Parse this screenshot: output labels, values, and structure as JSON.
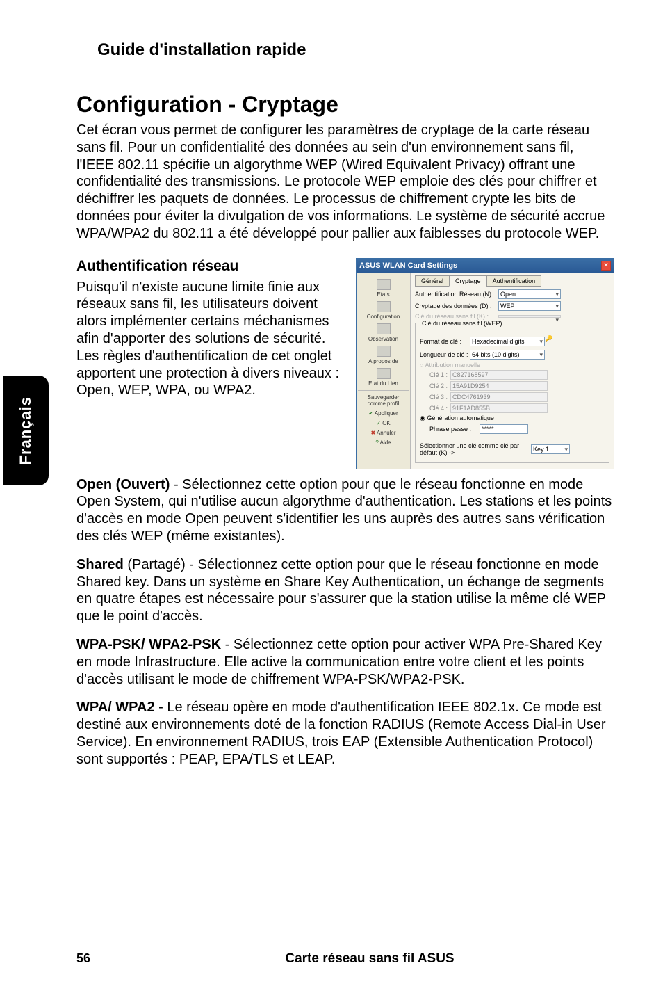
{
  "side_tab": "Français",
  "header": "Guide d'installation rapide",
  "title": "Configuration - Cryptage",
  "intro": "Cet écran vous permet de configurer les paramètres de cryptage de la carte réseau sans fil. Pour un confidentialité des données au sein d'un environnement sans fil, l'IEEE 802.11 spécifie un algorythme WEP (Wired Equivalent Privacy) offrant une confidentialité des transmissions. Le protocole WEP emploie des clés pour chiffrer et déchiffrer les paquets de données. Le processus de chiffrement crypte les bits de données pour éviter la divulgation de vos informations. Le système de sécurité accrue WPA/WPA2 du 802.11 a été développé pour pallier aux faiblesses du protocole WEP.",
  "section_heading": "Authentification réseau",
  "section_body": "Puisqu'il n'existe aucune limite finie aux réseaux sans fil, les utilisateurs doivent alors implémenter certains méchanismes afin d'apporter des solutions de sécurité. Les règles d'authentification de cet onglet apportent une protection à divers niveaux : Open, WEP, WPA, ou WPA2.",
  "open_label": "Open (Ouvert)",
  "open_text": " - Sélectionnez cette option pour que le réseau fonctionne en mode Open System, qui n'utilise aucun algorythme d'authentication. Les stations et les points d'accès en mode Open peuvent s'identifier les uns auprès des autres sans vérification des clés WEP (même existantes).",
  "shared_label": "Shared",
  "shared_text": " (Partagé) - Sélectionnez cette option pour que le réseau fonctionne en mode Shared key. Dans un système en Share Key Authentication, un échange de segments en quatre étapes est nécessaire pour s'assurer que la station utilise la même clé WEP que le point d'accès.",
  "wpa_psk_label": "WPA-PSK/ WPA2-PSK",
  "wpa_psk_text": " - Sélectionnez cette option pour activer WPA Pre-Shared Key en mode Infrastructure. Elle active la communication entre votre client et les points d'accès utilisant le mode de chiffrement WPA-PSK/WPA2-PSK.",
  "wpa_label": "WPA/ WPA2",
  "wpa_text": " - Le réseau opère en mode d'authentification IEEE 802.1x. Ce mode est destiné aux environnements doté de la fonction RADIUS (Remote Access Dial-in User Service). En environnement RADIUS, trois EAP (Extensible Authentication Protocol) sont supportés : PEAP, EPA/TLS et LEAP.",
  "dialog": {
    "title": "ASUS WLAN Card Settings",
    "close": "×",
    "nav": {
      "etats": "Etats",
      "configuration": "Configuration",
      "observation": "Observation",
      "apropos": "A propos de",
      "etat_lien": "Etat du Lien",
      "sauvegarder": "Sauvegarder comme profil",
      "appliquer": "Appliquer",
      "ok": "OK",
      "annuler": "Annuler",
      "aide": "Aide"
    },
    "tabs": {
      "general": "Général",
      "cryptage": "Cryptage",
      "auth": "Authentification"
    },
    "auth_reseau_label": "Authentification Réseau (N) :",
    "auth_reseau_value": "Open",
    "crypt_data_label": "Cryptage des données (D) :",
    "crypt_data_value": "WEP",
    "cle_reseau_disabled": "Clé du réseau sans fil (K) :",
    "wep_legend": "Clé du réseau sans fil (WEP)",
    "format_label": "Format de clé :",
    "format_value": "Hexadecimal digits",
    "longueur_label": "Longueur de clé :",
    "longueur_value": "64 bits (10 digits)",
    "attribution_manuelle": "Attribution manuelle",
    "cle1_label": "Clé 1 :",
    "cle1_value": "C827168597",
    "cle2_label": "Clé 2 :",
    "cle2_value": "15A91D9254",
    "cle3_label": "Clé 3 :",
    "cle3_value": "CDC4761939",
    "cle4_label": "Clé 4 :",
    "cle4_value": "91F1AD855B",
    "generation_auto": "Génération automatique",
    "phrase_label": "Phrase passe :",
    "phrase_value": "*****",
    "select_key_label": "Sélectionner une clé comme clé par défaut (K) ->",
    "select_key_value": "Key 1"
  },
  "footer": {
    "page": "56",
    "title": "Carte réseau sans fil ASUS"
  }
}
